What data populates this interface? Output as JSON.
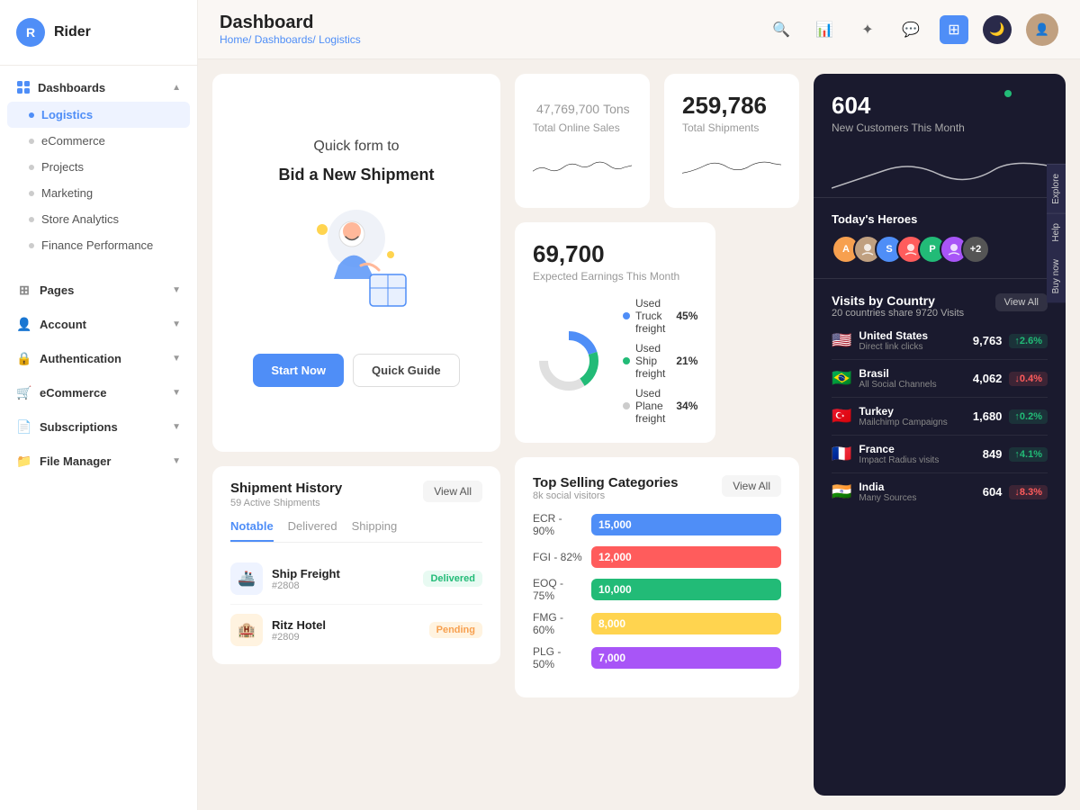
{
  "app": {
    "name": "Rider",
    "logo_letter": "R"
  },
  "sidebar": {
    "dashboards_label": "Dashboards",
    "items": [
      {
        "id": "logistics",
        "label": "Logistics",
        "active": true
      },
      {
        "id": "ecommerce",
        "label": "eCommerce",
        "active": false
      },
      {
        "id": "projects",
        "label": "Projects",
        "active": false
      },
      {
        "id": "marketing",
        "label": "Marketing",
        "active": false
      },
      {
        "id": "store-analytics",
        "label": "Store Analytics",
        "active": false
      },
      {
        "id": "finance-performance",
        "label": "Finance Performance",
        "active": false
      }
    ],
    "pages_label": "Pages",
    "account_label": "Account",
    "authentication_label": "Authentication",
    "ecommerce_label": "eCommerce",
    "subscriptions_label": "Subscriptions",
    "file_manager_label": "File Manager"
  },
  "header": {
    "title": "Dashboard",
    "breadcrumb": [
      "Home",
      "Dashboards",
      "Logistics"
    ]
  },
  "bid_card": {
    "title": "Quick form to",
    "subtitle": "Bid a New Shipment",
    "start_now": "Start Now",
    "quick_guide": "Quick Guide"
  },
  "stats": {
    "total_sales_value": "47,769,700",
    "total_sales_unit": "Tons",
    "total_sales_label": "Total Online Sales",
    "total_shipments_value": "259,786",
    "total_shipments_label": "Total Shipments",
    "earnings_value": "69,700",
    "earnings_label": "Expected Earnings This Month",
    "new_customers_value": "604",
    "new_customers_label": "New Customers This Month"
  },
  "freight": {
    "truck_label": "Used Truck freight",
    "truck_pct": "45%",
    "ship_label": "Used Ship freight",
    "ship_pct": "21%",
    "plane_label": "Used Plane freight",
    "plane_pct": "34%",
    "truck_color": "#4f8ef7",
    "ship_color": "#22bb77",
    "plane_color": "#e0e0e0"
  },
  "shipment_history": {
    "title": "Shipment History",
    "subtitle": "59 Active Shipments",
    "view_all": "View All",
    "tabs": [
      "Notable",
      "Delivered",
      "Shipping"
    ],
    "items": [
      {
        "icon": "🚢",
        "name": "Ship Freight",
        "id": "2808",
        "status": "Delivered"
      }
    ]
  },
  "categories": {
    "title": "Top Selling Categories",
    "subtitle": "8k social visitors",
    "view_all": "View All",
    "bars": [
      {
        "label": "ECR - 90%",
        "value": "15,000",
        "color": "#4f8ef7"
      },
      {
        "label": "FGI - 82%",
        "value": "12,000",
        "color": "#ff5c5c"
      },
      {
        "label": "EOQ - 75%",
        "value": "10,000",
        "color": "#22bb77"
      },
      {
        "label": "FMG - 60%",
        "value": "8,000",
        "color": "#ffd44f"
      },
      {
        "label": "PLG - 50%",
        "value": "7,000",
        "color": "#a855f7"
      }
    ]
  },
  "visits": {
    "title": "Visits by Country",
    "subtitle": "20 countries share 9720 Visits",
    "view_all": "View All",
    "countries": [
      {
        "flag": "🇺🇸",
        "name": "United States",
        "source": "Direct link clicks",
        "visits": "9,763",
        "change": "+2.6%",
        "up": true
      },
      {
        "flag": "🇧🇷",
        "name": "Brasil",
        "source": "All Social Channels",
        "visits": "4,062",
        "change": "-0.4%",
        "up": false
      },
      {
        "flag": "🇹🇷",
        "name": "Turkey",
        "source": "Mailchimp Campaigns",
        "visits": "1,680",
        "change": "+0.2%",
        "up": true
      },
      {
        "flag": "🇫🇷",
        "name": "France",
        "source": "Impact Radius visits",
        "visits": "849",
        "change": "+4.1%",
        "up": true
      },
      {
        "flag": "🇮🇳",
        "name": "India",
        "source": "Many Sources",
        "visits": "604",
        "change": "-8.3%",
        "up": false
      }
    ]
  },
  "heroes": {
    "title": "Today's Heroes",
    "avatars": [
      {
        "letter": "A",
        "color": "#f7a04f"
      },
      {
        "letter": "",
        "color": "#c0a080"
      },
      {
        "letter": "S",
        "color": "#4f8ef7"
      },
      {
        "letter": "",
        "color": "#ff5c5c"
      },
      {
        "letter": "P",
        "color": "#22bb77"
      },
      {
        "letter": "",
        "color": "#a855f7"
      },
      {
        "letter": "+2",
        "color": "#555"
      }
    ]
  },
  "side_labels": [
    "Explore",
    "Help",
    "Buy now"
  ],
  "dark_stat": {
    "value": "604",
    "label": "New Customers This Month"
  }
}
